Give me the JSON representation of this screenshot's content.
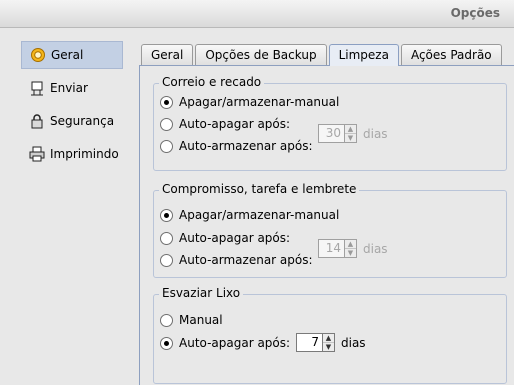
{
  "window": {
    "title": "Opções"
  },
  "sidebar": {
    "items": [
      {
        "label": "Geral",
        "icon": "gear-icon",
        "selected": true
      },
      {
        "label": "Enviar",
        "icon": "send-icon",
        "selected": false
      },
      {
        "label": "Segurança",
        "icon": "lock-icon",
        "selected": false
      },
      {
        "label": "Imprimindo",
        "icon": "printer-icon",
        "selected": false
      }
    ]
  },
  "tabs": [
    {
      "label": "Geral",
      "active": false
    },
    {
      "label": "Opções de Backup",
      "active": false
    },
    {
      "label": "Limpeza",
      "active": true
    },
    {
      "label": "Ações Padrão",
      "active": false
    }
  ],
  "groups": {
    "correio": {
      "title": "Correio e recado",
      "options": [
        {
          "label": "Apagar/armazenar-manual",
          "checked": true
        },
        {
          "label": "Auto-apagar após:",
          "checked": false
        },
        {
          "label": "Auto-armazenar após:",
          "checked": false
        }
      ],
      "spinner": {
        "value": "30",
        "unit": "dias",
        "enabled": false
      }
    },
    "compromisso": {
      "title": "Compromisso, tarefa e lembrete",
      "options": [
        {
          "label": "Apagar/armazenar-manual",
          "checked": true
        },
        {
          "label": "Auto-apagar após:",
          "checked": false
        },
        {
          "label": "Auto-armazenar após:",
          "checked": false
        }
      ],
      "spinner": {
        "value": "14",
        "unit": "dias",
        "enabled": false
      }
    },
    "lixo": {
      "title": "Esvaziar Lixo",
      "options": [
        {
          "label": "Manual",
          "checked": false
        },
        {
          "label": "Auto-apagar após:",
          "checked": true
        }
      ],
      "spinner": {
        "value": "7",
        "unit": "dias",
        "enabled": true
      }
    }
  },
  "colors": {
    "accent": "#c3d0e4",
    "tab_active": "#e8edf5",
    "group_border": "#b9c4d8"
  }
}
